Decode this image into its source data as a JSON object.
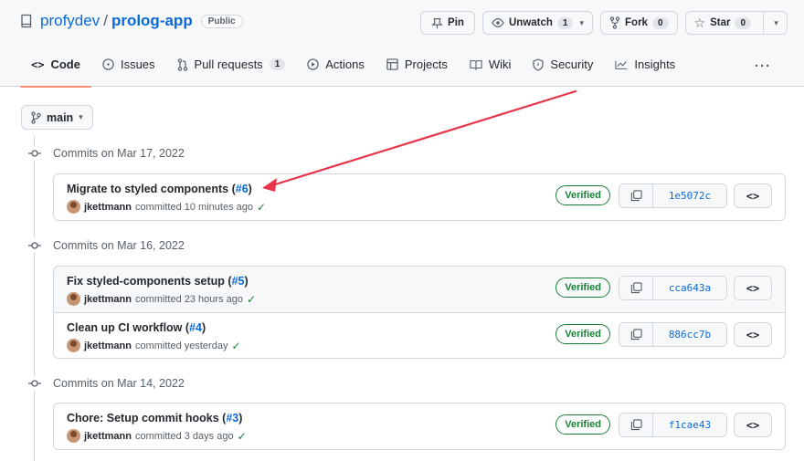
{
  "repo": {
    "owner": "profydev",
    "separator": "/",
    "name": "prolog-app",
    "visibility": "Public"
  },
  "header_actions": {
    "pin": "Pin",
    "unwatch": "Unwatch",
    "unwatch_count": "1",
    "fork": "Fork",
    "fork_count": "0",
    "star": "Star",
    "star_count": "0"
  },
  "tabs": [
    {
      "label": "Code",
      "icon": "code-icon"
    },
    {
      "label": "Issues",
      "icon": "issue-icon"
    },
    {
      "label": "Pull requests",
      "icon": "pull-request-icon",
      "count": "1"
    },
    {
      "label": "Actions",
      "icon": "play-icon"
    },
    {
      "label": "Projects",
      "icon": "table-icon"
    },
    {
      "label": "Wiki",
      "icon": "book-icon"
    },
    {
      "label": "Security",
      "icon": "shield-icon"
    },
    {
      "label": "Insights",
      "icon": "graph-icon"
    }
  ],
  "more_label": "···",
  "branch": {
    "name": "main"
  },
  "days": [
    {
      "heading": "Commits on Mar 17, 2022",
      "commits": [
        {
          "title": "Migrate to styled components (",
          "pr": "#6",
          "close": ")",
          "author": "jkettmann",
          "meta": "committed 10 minutes ago",
          "verified": "Verified",
          "sha": "1e5072c"
        }
      ]
    },
    {
      "heading": "Commits on Mar 16, 2022",
      "commits": [
        {
          "title": "Fix styled-components setup (",
          "pr": "#5",
          "close": ")",
          "author": "jkettmann",
          "meta": "committed 23 hours ago",
          "verified": "Verified",
          "sha": "cca643a"
        },
        {
          "title": "Clean up CI workflow (",
          "pr": "#4",
          "close": ")",
          "author": "jkettmann",
          "meta": "committed yesterday",
          "verified": "Verified",
          "sha": "886cc7b"
        }
      ]
    },
    {
      "heading": "Commits on Mar 14, 2022",
      "commits": [
        {
          "title": "Chore: Setup commit hooks (",
          "pr": "#3",
          "close": ")",
          "author": "jkettmann",
          "meta": "committed 3 days ago",
          "verified": "Verified",
          "sha": "f1cae43"
        }
      ]
    }
  ],
  "browse_label": "<>",
  "colors": {
    "link": "#0969da",
    "verified": "#1a7f37",
    "annotation_arrow": "#e8344a",
    "active_tab": "#fd8c73"
  }
}
